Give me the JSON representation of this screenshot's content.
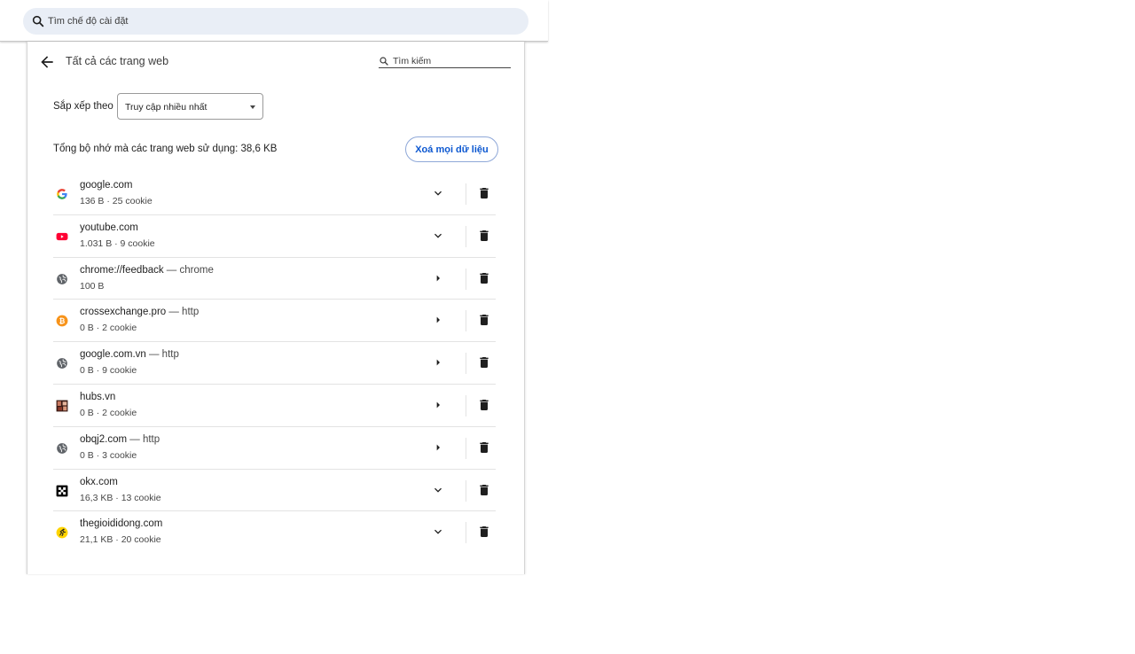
{
  "search": {
    "placeholder": "Tìm chế độ cài đặt"
  },
  "page": {
    "title": "Tất cả các trang web",
    "search_placeholder": "Tìm kiếm"
  },
  "sort": {
    "label": "Sắp xếp theo",
    "selected": "Truy cập nhiều nhất"
  },
  "storage": {
    "total_text": "Tổng bộ nhớ mà các trang web sử dụng: 38,6 KB",
    "clear_all_label": "Xoá mọi dữ liệu"
  },
  "sites": [
    {
      "name": "google.com",
      "scheme": "",
      "detail": "136 B · 25 cookie",
      "icon": "google-icon",
      "expand": "chevron-down"
    },
    {
      "name": "youtube.com",
      "scheme": "",
      "detail": "1.031 B · 9 cookie",
      "icon": "youtube-icon",
      "expand": "chevron-down"
    },
    {
      "name": "chrome://feedback",
      "scheme": " — chrome",
      "detail": "100 B",
      "icon": "globe-icon",
      "expand": "arrow-right"
    },
    {
      "name": "crossexchange.pro",
      "scheme": " — http",
      "detail": "0 B · 2 cookie",
      "icon": "bitcoin-icon",
      "expand": "arrow-right"
    },
    {
      "name": "google.com.vn",
      "scheme": " — http",
      "detail": "0 B · 9 cookie",
      "icon": "globe-icon",
      "expand": "arrow-right"
    },
    {
      "name": "hubs.vn",
      "scheme": "",
      "detail": "0 B · 2 cookie",
      "icon": "hubs-icon",
      "expand": "arrow-right"
    },
    {
      "name": "obqj2.com",
      "scheme": " — http",
      "detail": "0 B · 3 cookie",
      "icon": "globe-icon",
      "expand": "arrow-right"
    },
    {
      "name": "okx.com",
      "scheme": "",
      "detail": "16,3 KB · 13 cookie",
      "icon": "okx-icon",
      "expand": "chevron-down"
    },
    {
      "name": "thegioididong.com",
      "scheme": "",
      "detail": "21,1 KB · 20 cookie",
      "icon": "thegioididong-icon",
      "expand": "chevron-down"
    }
  ],
  "colors": {
    "accent": "#0b57d0",
    "search_bg": "#e9eef6",
    "youtube_red": "#ff0033",
    "bitcoin_orange": "#f7931a",
    "tgdd_yellow": "#ffd400"
  }
}
